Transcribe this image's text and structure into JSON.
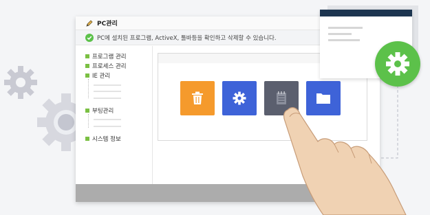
{
  "window": {
    "title": "PC관리",
    "title_icon": "pencil-icon",
    "info_icon": "check-circle-icon",
    "info_text": "PC에 설치된 프로그램, ActiveX, 툴바등을 확인하고 삭제할 수 있습니다."
  },
  "sidebar": {
    "items": [
      {
        "label": "프로그램 관리"
      },
      {
        "label": "프로세스 관리"
      },
      {
        "label": "IE 관리"
      },
      {
        "label": "부팅관리"
      },
      {
        "label": "시스템 정보"
      }
    ]
  },
  "tiles": [
    {
      "icon": "trash-icon",
      "color": "#f59a2c"
    },
    {
      "icon": "gear-icon",
      "color": "#3e63d8"
    },
    {
      "icon": "notepad-icon",
      "color": "#5b5f6e"
    },
    {
      "icon": "folder-icon",
      "color": "#3e63d8"
    }
  ],
  "colors": {
    "accent_green": "#5cc14a",
    "popup_header": "#1c3550"
  }
}
